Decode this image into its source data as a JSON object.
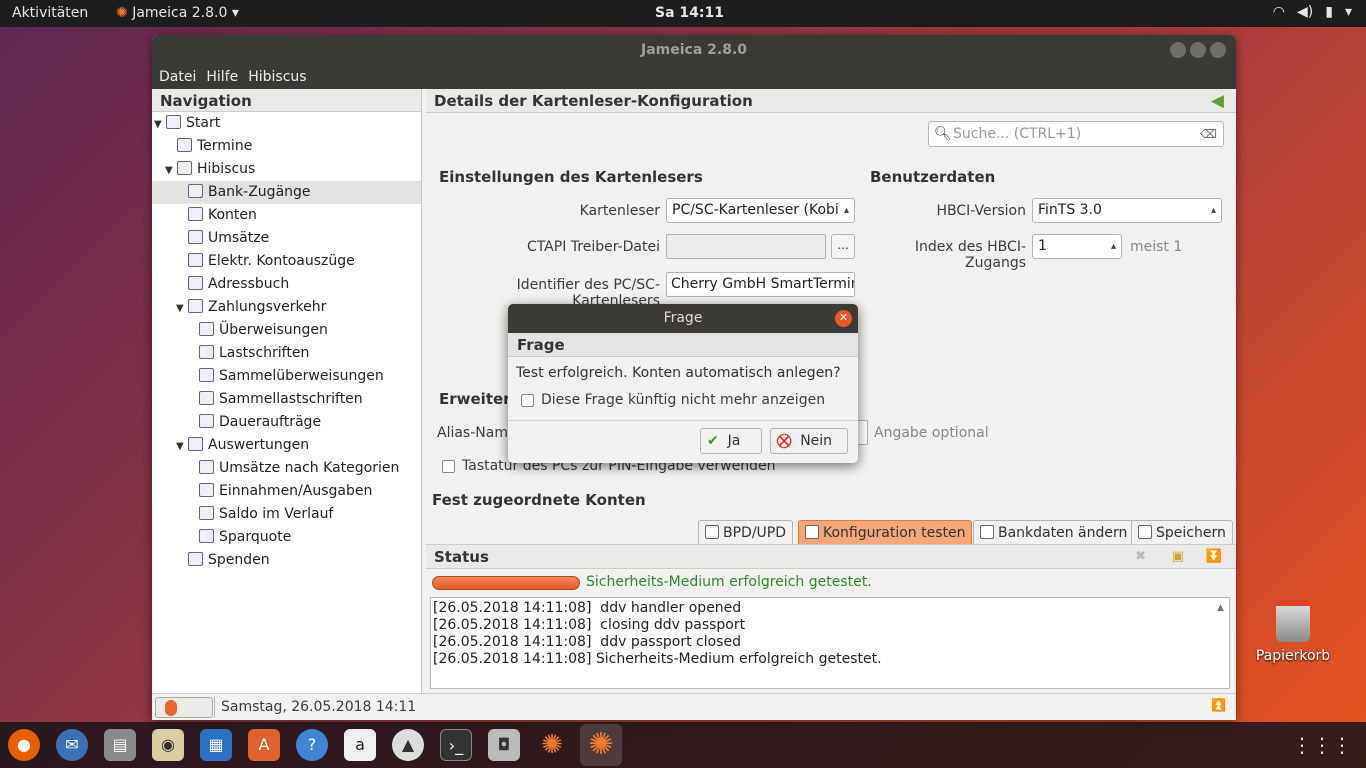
{
  "topbar": {
    "activities": "Aktivitäten",
    "app_menu": "Jameica 2.8.0 ▾",
    "clock": "Sa 14:11"
  },
  "window": {
    "title": "Jameica 2.8.0"
  },
  "menu": [
    "Datei",
    "Hilfe",
    "Hibiscus"
  ],
  "navigation": {
    "title": "Navigation",
    "items": [
      {
        "label": "Start",
        "level": 0,
        "expander": "▼",
        "icon": "monitor-icon"
      },
      {
        "label": "Termine",
        "level": 1,
        "expander": "",
        "icon": "calendar-icon"
      },
      {
        "label": "Hibiscus",
        "level": 1,
        "expander": "▼",
        "icon": "folder-icon"
      },
      {
        "label": "Bank-Zugänge",
        "level": 2,
        "expander": "",
        "icon": "bank-access-icon",
        "selected": true
      },
      {
        "label": "Konten",
        "level": 2,
        "expander": "",
        "icon": "accounts-icon"
      },
      {
        "label": "Umsätze",
        "level": 2,
        "expander": "",
        "icon": "transactions-icon"
      },
      {
        "label": "Elektr. Kontoauszüge",
        "level": 2,
        "expander": "",
        "icon": "pdf-icon"
      },
      {
        "label": "Adressbuch",
        "level": 2,
        "expander": "",
        "icon": "addressbook-icon"
      },
      {
        "label": "Zahlungsverkehr",
        "level": 2,
        "expander": "▼",
        "icon": "folder-icon"
      },
      {
        "label": "Überweisungen",
        "level": 3,
        "expander": "",
        "icon": "transfer-icon"
      },
      {
        "label": "Lastschriften",
        "level": 3,
        "expander": "",
        "icon": "debit-icon"
      },
      {
        "label": "Sammelüberweisungen",
        "level": 3,
        "expander": "",
        "icon": "collective-transfer-icon"
      },
      {
        "label": "Sammellastschriften",
        "level": 3,
        "expander": "",
        "icon": "collective-debit-icon"
      },
      {
        "label": "Daueraufträge",
        "level": 3,
        "expander": "",
        "icon": "standing-order-icon"
      },
      {
        "label": "Auswertungen",
        "level": 2,
        "expander": "▼",
        "icon": "folder-icon"
      },
      {
        "label": "Umsätze nach Kategorien",
        "level": 3,
        "expander": "",
        "icon": "pie-chart-icon"
      },
      {
        "label": "Einnahmen/Ausgaben",
        "level": 3,
        "expander": "",
        "icon": "income-expense-icon"
      },
      {
        "label": "Saldo im Verlauf",
        "level": 3,
        "expander": "",
        "icon": "balance-chart-icon"
      },
      {
        "label": "Sparquote",
        "level": 3,
        "expander": "",
        "icon": "savings-icon"
      },
      {
        "label": "Spenden",
        "level": 2,
        "expander": "",
        "icon": "star-icon"
      }
    ]
  },
  "details": {
    "title": "Details der Kartenleser-Konfiguration",
    "search_placeholder": "Suche...  (CTRL+1)",
    "reader_section": "Einstellungen des Kartenlesers",
    "reader_label": "Kartenleser",
    "reader_value": "PC/SC-Kartenleser (Kobi",
    "ctapi_label": "CTAPI Treiber-Datei",
    "ctapi_value": "",
    "browse_label": "...",
    "identifier_label": "Identifier des PC/SC-Kartenlesers",
    "identifier_value": "Cherry GmbH SmartTermina",
    "user_section": "Benutzerdaten",
    "hbci_label": "HBCI-Version",
    "hbci_value": "FinTS 3.0",
    "index_label": "Index des HBCI-Zugangs",
    "index_value": "1",
    "index_hint": "meist 1",
    "advanced_section": "Erweitert",
    "alias_label": "Alias-Name",
    "alias_hint": "Angabe optional",
    "keyboard_label": "Tastatur des PCs zur PIN-Eingabe verwenden",
    "accounts_section": "Fest zugeordnete Konten",
    "buttons": [
      "BPD/UPD",
      "Konfiguration testen",
      "Bankdaten ändern",
      "Speichern"
    ]
  },
  "status": {
    "title": "Status",
    "progress": 1.0,
    "message": "Sicherheits-Medium erfolgreich getestet.",
    "log": [
      "[26.05.2018 14:11:08]  ddv handler opened",
      "[26.05.2018 14:11:08]  closing ddv passport",
      "[26.05.2018 14:11:08]  ddv passport closed",
      "[26.05.2018 14:11:08] Sicherheits-Medium erfolgreich getestet."
    ]
  },
  "bottom": {
    "datetime": "Samstag, 26.05.2018 14:11"
  },
  "dialog": {
    "window_title": "Frage",
    "header": "Frage",
    "question": "Test erfolgreich. Konten automatisch anlegen?",
    "checkbox_label": "Diese Frage künftig nicht mehr anzeigen",
    "yes": "Ja",
    "no": "Nein"
  },
  "desktop": {
    "trash": "Papierkorb"
  },
  "colors": {
    "accent": "#e9541f",
    "success": "#2a8c2a",
    "titlebar": "#3a3a37"
  }
}
